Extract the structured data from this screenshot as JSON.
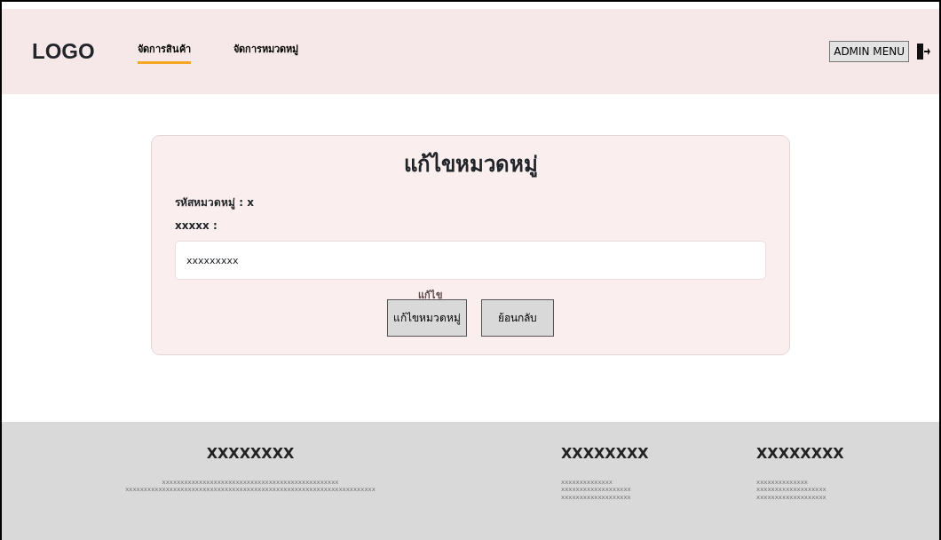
{
  "header": {
    "logo": "LOGO",
    "tabs": [
      {
        "label": "จัดการสินค้า",
        "selected": true
      },
      {
        "label": "จัดการหมวดหมู่",
        "selected": false
      }
    ],
    "admin_menu": "ADMIN MENU"
  },
  "form": {
    "title": "แก้ไขหมวดหมู่",
    "code_label": "รหัสหมวดหมู่ : x",
    "field_label": "xxxxx :",
    "field_value": "xxxxxxxxx",
    "hint": "แก้ไข",
    "buttons": [
      "แก้ไขหมวดหมู่",
      "ย้อนกลับ"
    ]
  },
  "footer": {
    "columns": [
      {
        "heading": "XXXXXXXX",
        "lines": [
          "xxxxxxxxxxxxxxxxxxxxxxxxxxxxxxxxxxxxxxxxxxxxxxxx",
          "xxxxxxxxxxxxxxxxxxxxxxxxxxxxxxxxxxxxxxxxxxxxxxxxxxxxxxxxxxxxxxxxxxxx"
        ]
      },
      {
        "heading": "XXXXXXXX",
        "lines": [
          "xxxxxxxxxxxxxx",
          "xxxxxxxxxxxxxxxxxxx",
          "xxxxxxxxxxxxxxxxxxx"
        ]
      },
      {
        "heading": "XXXXXXXX",
        "lines": [
          "xxxxxxxxxxxxxx",
          "xxxxxxxxxxxxxxxxxxx",
          "xxxxxxxxxxxxxxxxxxx"
        ]
      }
    ]
  }
}
